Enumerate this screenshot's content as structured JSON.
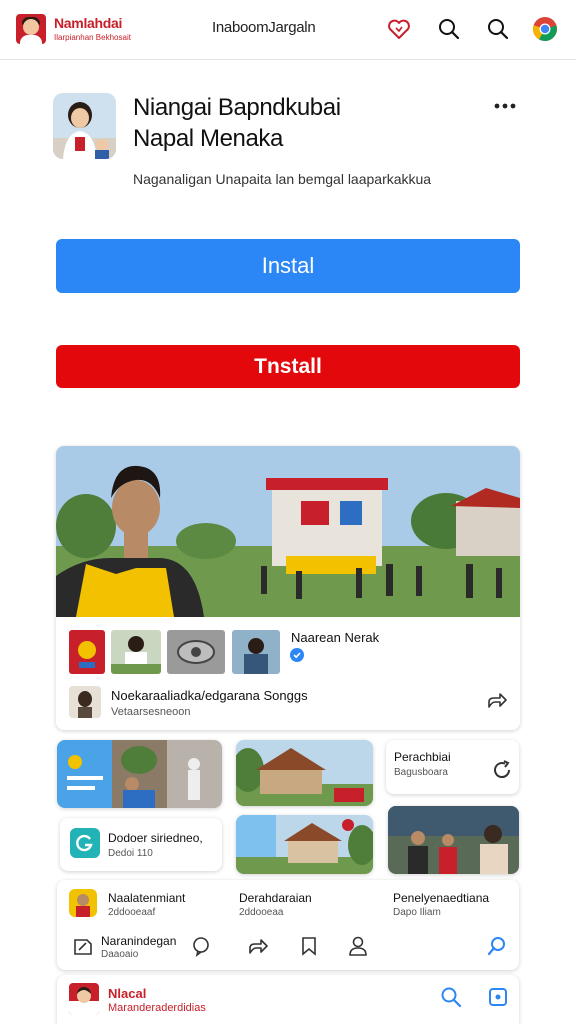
{
  "topbar": {
    "brand_name": "Namlahdai",
    "brand_tag": "Ilarpianhan Bekhosait",
    "title": "InaboomJargaln",
    "icons": [
      "heart-icon",
      "search-icon",
      "search-icon",
      "chrome-icon"
    ]
  },
  "app": {
    "title_line1": "Niangai Bapndkubai",
    "title_line2": "Napal Menaka",
    "description": "Naganaligan Unapaita lan bemgal laaparkakkua",
    "install_primary": "Instal",
    "install_secondary": "Tnstall"
  },
  "feature": {
    "strip_title": "Naarean Nerak",
    "row_title": "Noekaraaliadka/edgarana Songgs",
    "row_sub": "Vetaarsesneoon"
  },
  "grid": {
    "card_right_title": "Perachbiai",
    "card_right_sub": "Bagusboara",
    "card_left_title": "Dodoer siriedneo,",
    "card_left_sub": "Dedoi 110"
  },
  "bottom_panel": {
    "col1_title": "Naalatenmiant",
    "col1_sub": "2ddooeaaf",
    "col2_title": "Derahdaraian",
    "col2_sub": "2ddooeaa",
    "col3_title": "Penelyenaedtiana",
    "col3_sub": "Dapo Iliam",
    "nav_label": "Naranindegan",
    "nav_sub": "Daaoaio"
  },
  "footer": {
    "title": "Nlacal",
    "sub": "Maranderaderdidias"
  },
  "colors": {
    "primary_blue": "#2b87f5",
    "install_red": "#e3080c",
    "brand_red": "#c8202a"
  }
}
